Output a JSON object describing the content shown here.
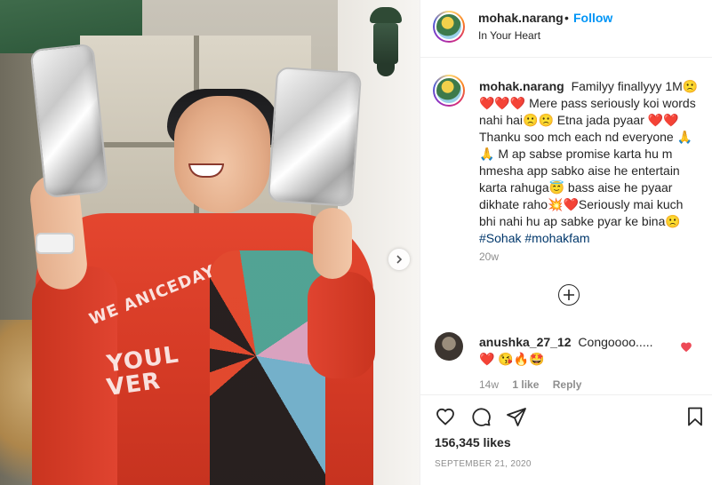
{
  "post": {
    "photo": {
      "jacket_text_1": "WE ANICEDAY",
      "jacket_text_2": "YOUL",
      "jacket_text_3": "VER",
      "next_icon": "chevron-right-icon"
    },
    "header": {
      "username": "mohak.narang",
      "separator": "•",
      "follow_label": "Follow",
      "location": "In Your Heart"
    },
    "caption": {
      "username": "mohak.narang",
      "text": "Familyy finallyyy 1M🙁 ❤️❤️❤️ Mere pass seriously koi words nahi hai🙁🙁 Etna jada pyaar ❤️❤️ Thanku soo mch each nd everyone 🙏🙏 M ap sabse promise karta hu m hmesha app sabko aise he entertain karta rahuga😇 bass aise he pyaar dikhate raho💥❤️Seriously mai kuch bhi nahi hu ap sabke pyar ke bina🙁",
      "hashtags": "#Sohak #mohakfam",
      "time": "20w"
    },
    "load_more_icon": "plus-circle-icon",
    "comment": {
      "username": "anushka_27_12",
      "text": "Congoooo.....❤️ 😘🔥🤩",
      "time": "14w",
      "likes": "1 like",
      "reply_label": "Reply",
      "heart_color": "#ed4956"
    },
    "actions": {
      "like_icon": "heart-icon",
      "comment_icon": "comment-icon",
      "share_icon": "share-icon",
      "save_icon": "bookmark-icon"
    },
    "likes_count": "156,345 likes",
    "date": "SEPTEMBER 21, 2020"
  }
}
